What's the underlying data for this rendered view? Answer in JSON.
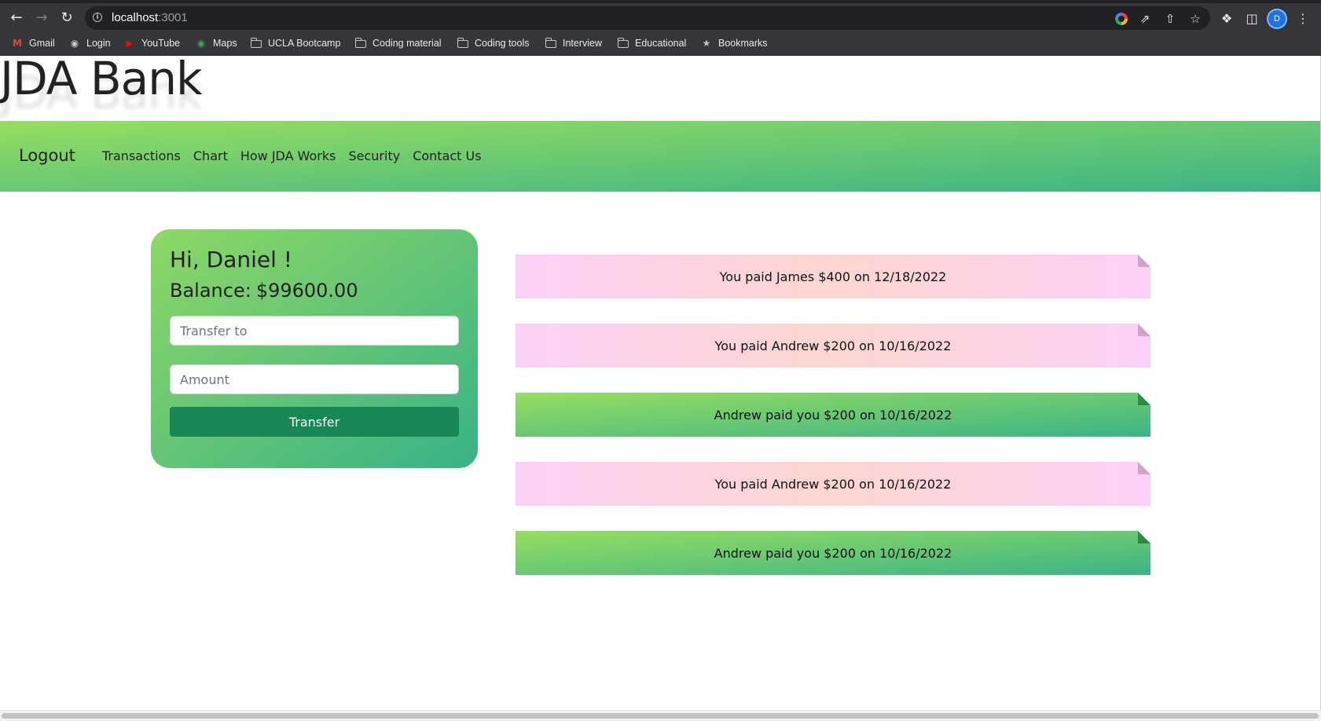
{
  "browser": {
    "url_host": "localhost",
    "url_port": ":3001",
    "nav": {
      "back_icon": "back-arrow-icon",
      "forward_icon": "forward-arrow-icon",
      "reload_icon": "reload-icon"
    },
    "profile_initial": "D",
    "bookmarks": [
      {
        "label": "Gmail",
        "icon": "gmail-icon"
      },
      {
        "label": "Login",
        "icon": "globe-icon"
      },
      {
        "label": "YouTube",
        "icon": "youtube-icon"
      },
      {
        "label": "Maps",
        "icon": "maps-icon"
      },
      {
        "label": "UCLA Bootcamp",
        "icon": "folder-icon"
      },
      {
        "label": "Coding material",
        "icon": "folder-icon"
      },
      {
        "label": "Coding tools",
        "icon": "folder-icon"
      },
      {
        "label": "Interview",
        "icon": "folder-icon"
      },
      {
        "label": "Educational",
        "icon": "folder-icon"
      },
      {
        "label": "Bookmarks",
        "icon": "star-icon"
      }
    ]
  },
  "page": {
    "title": "JDA Bank",
    "navbar": {
      "brand": "Logout",
      "links": [
        "Transactions",
        "Chart",
        "How JDA Works",
        "Security",
        "Contact Us"
      ]
    },
    "account": {
      "greeting": "Hi, Daniel !",
      "balance_label": "Balance:",
      "balance_value": "$99600.00",
      "transfer_to_placeholder": "Transfer to",
      "amount_placeholder": "Amount",
      "transfer_button": "Transfer"
    },
    "transactions": [
      {
        "text": "You paid James $400 on 12/18/2022",
        "direction": "paid"
      },
      {
        "text": "You paid Andrew $200 on 10/16/2022",
        "direction": "paid"
      },
      {
        "text": "Andrew paid you $200 on 10/16/2022",
        "direction": "received"
      },
      {
        "text": "You paid Andrew $200 on 10/16/2022",
        "direction": "paid"
      },
      {
        "text": "Andrew paid you $200 on 10/16/2022",
        "direction": "received"
      }
    ]
  },
  "colors": {
    "brand_green_start": "#96de60",
    "brand_green_end": "#3cb386",
    "paid_pink": "#fdd1f7",
    "paid_peach": "#fcd6cf",
    "button_green": "#198754"
  }
}
